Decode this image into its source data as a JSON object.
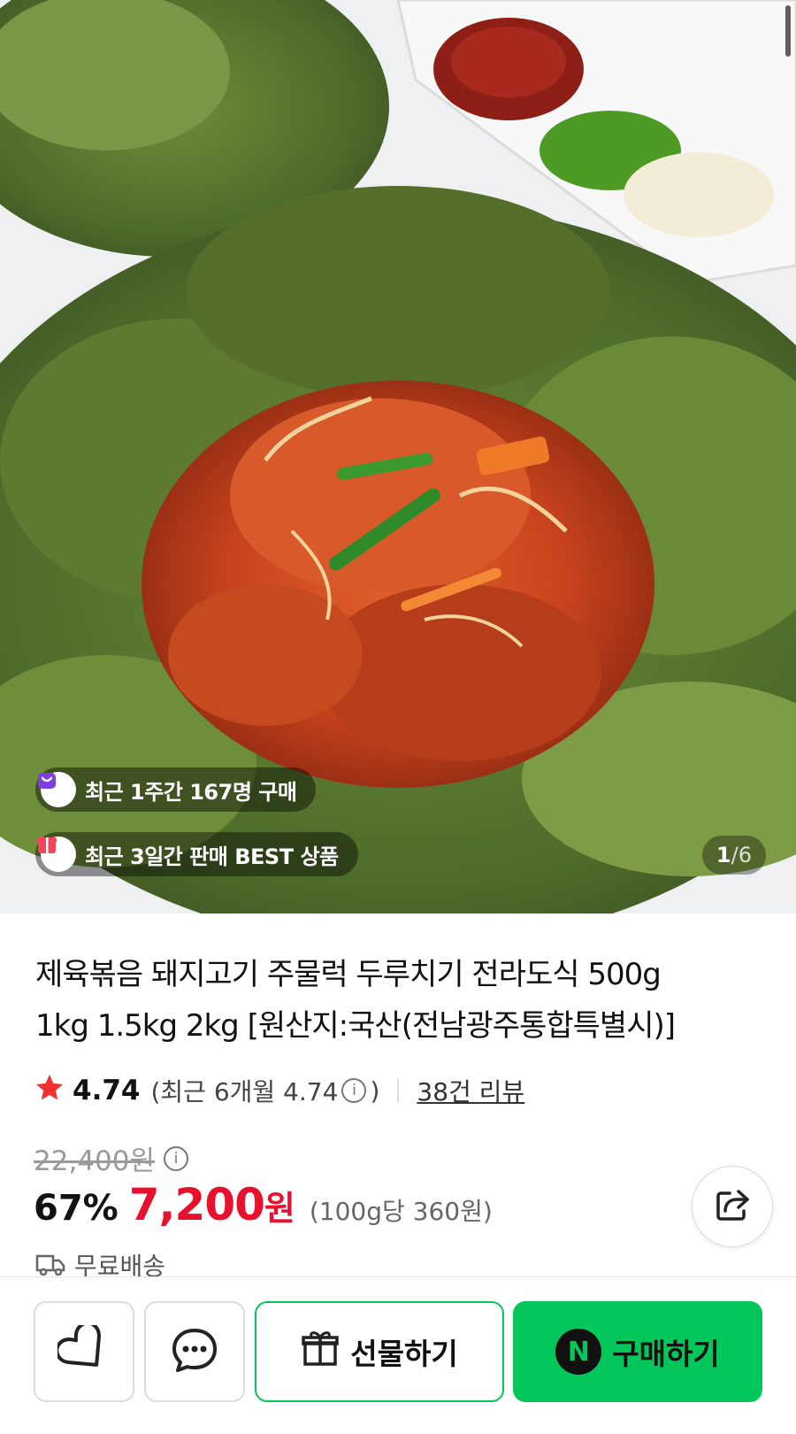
{
  "badges": {
    "recent_buyers": "최근 1주간 167명 구매",
    "best_seller": "최근 3일간 판매 BEST 상품"
  },
  "gallery": {
    "current": "1",
    "separator": "/",
    "total": "6"
  },
  "product": {
    "title_line1": "제육볶음 돼지고기 주물럭 두루치기 전라도식 500g",
    "title_line2": "1kg 1.5kg 2kg [원산지:국산(전남광주통합특별시)]"
  },
  "rating": {
    "star": "★",
    "score": "4.74",
    "recent_prefix": "(최근 6개월 4.74",
    "recent_suffix": ")",
    "reviews": "38건 리뷰"
  },
  "price": {
    "original": "22,400원",
    "discount": "67%",
    "sale": "7,200",
    "currency": "원",
    "unit_price": "(100g당 360원)"
  },
  "shipping": {
    "label": "무료배송"
  },
  "actions": {
    "gift": "선물하기",
    "buy": "구매하기",
    "naver_logo": "N"
  },
  "colors": {
    "naver_green": "#03c75a",
    "price_red": "#e8112d",
    "badge_purple": "#7b3fe4",
    "badge_red": "#f0475b"
  },
  "icons": [
    "heart-icon",
    "chat-icon",
    "gift-icon",
    "share-icon",
    "truck-icon",
    "info-icon",
    "star-icon"
  ]
}
